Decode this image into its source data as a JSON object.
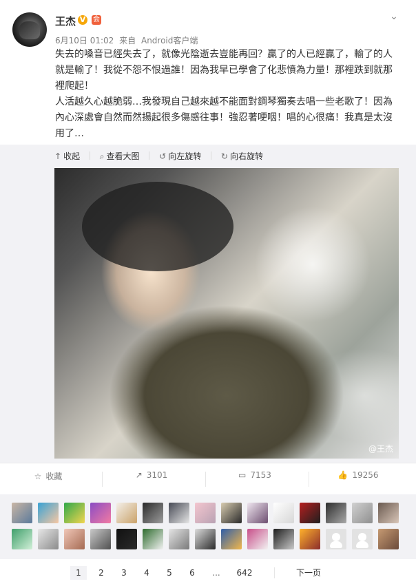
{
  "post": {
    "username": "王杰",
    "verify_badge": "V",
    "vip_badge": "会",
    "date": "6月10日 01:02",
    "source_prefix": "来自",
    "source": "Android客户端",
    "text_p1": "失去的嗓音已經失去了，就像光陰逝去豈能再回？贏了的人已經贏了，輸了的人就是輸了！我從不怨不恨過誰！因為我早已學會了化悲憤為力量！那裡跌到就那裡爬起！",
    "text_p2": "人活越久心越脆弱…我發現自己越來越不能面對鋼琴獨奏去唱一些老歌了！因為內心深處會自然而然揚起很多傷感往事！強忍著哽咽！唱的心很痛！我真是太沒用了…"
  },
  "image_tools": {
    "collapse": "收起",
    "view_large": "查看大图",
    "rotate_left": "向左旋转",
    "rotate_right": "向右旋转"
  },
  "image": {
    "watermark": "@王杰"
  },
  "actions": {
    "favorite": "收藏",
    "forward_count": "3101",
    "comment_count": "7153",
    "like_count": "19256"
  },
  "icons": {
    "verify": "verified-v-icon",
    "vip": "member-icon",
    "caret": "chevron-down-icon",
    "favorite": "star-icon",
    "forward": "share-icon",
    "comment": "comment-icon",
    "like": "thumbs-up-icon",
    "collapse": "arrow-up-icon",
    "view_large": "search-icon",
    "rotate_left": "rotate-left-icon",
    "rotate_right": "rotate-right-icon"
  },
  "pager": {
    "pages": [
      "1",
      "2",
      "3",
      "4",
      "5",
      "6"
    ],
    "ellipsis": "...",
    "last": "642",
    "next": "下一页"
  },
  "colors": {
    "accent_like": "#f15a5a",
    "panel_bg": "#f2f2f5",
    "badge_v": "#f6a70a"
  }
}
